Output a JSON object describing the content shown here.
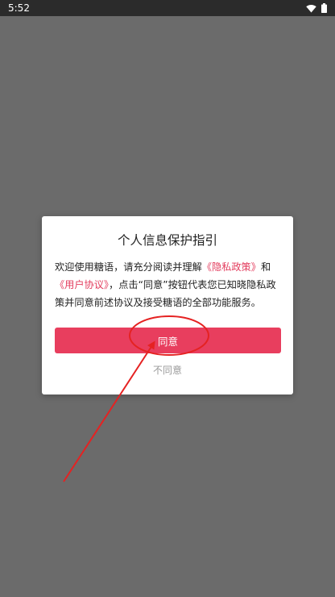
{
  "status_bar": {
    "time": "5:52"
  },
  "dialog": {
    "title": "个人信息保护指引",
    "body": {
      "text1": "欢迎使用糖语，请充分阅读并理解",
      "privacy_link": "《隐私政策》",
      "text2": "和",
      "user_agreement_link": "《用户协议》",
      "text3": "，点击“同意”按钮代表您已知晓隐私政策并同意前述协议及接受糖语的全部功能服务。"
    },
    "agree_label": "同意",
    "disagree_label": "不同意"
  },
  "colors": {
    "accent": "#e83e5e",
    "link": "#e33d5e",
    "overlay": "#6b6b6b",
    "annotation": "#e52222"
  },
  "icons": [
    "wifi-icon",
    "battery-icon"
  ]
}
